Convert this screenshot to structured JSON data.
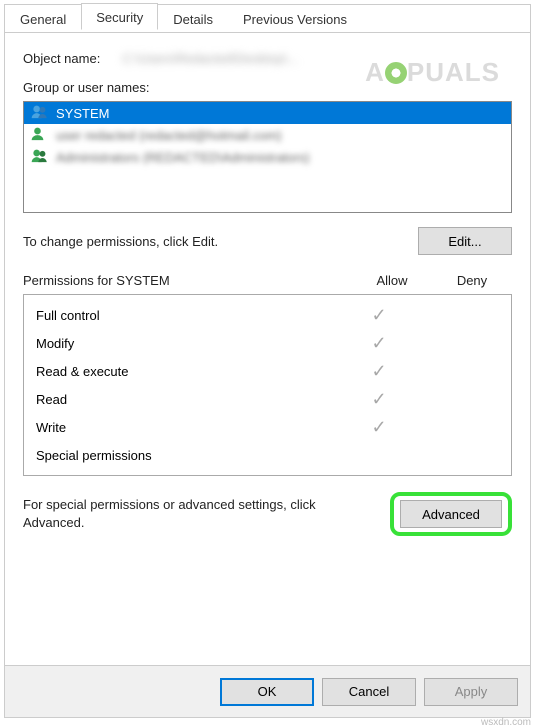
{
  "tabs": {
    "general": "General",
    "security": "Security",
    "details": "Details",
    "previous": "Previous Versions"
  },
  "objectName": {
    "label": "Object name:",
    "value": "C:\\Users\\Redacted\\Desktop\\..."
  },
  "groupLabel": "Group or user names:",
  "users": [
    {
      "name": "SYSTEM",
      "type": "group",
      "selected": true
    },
    {
      "name": "user redacted (redacted@hotmail.com)",
      "type": "user",
      "selected": false
    },
    {
      "name": "Administrators (REDACTED\\Administrators)",
      "type": "group",
      "selected": false
    }
  ],
  "editHint": "To change permissions, click Edit.",
  "editBtn": "Edit...",
  "permHeader": {
    "for": "Permissions for SYSTEM",
    "allow": "Allow",
    "deny": "Deny"
  },
  "permissions": [
    {
      "name": "Full control",
      "allow": true,
      "deny": false
    },
    {
      "name": "Modify",
      "allow": true,
      "deny": false
    },
    {
      "name": "Read & execute",
      "allow": true,
      "deny": false
    },
    {
      "name": "Read",
      "allow": true,
      "deny": false
    },
    {
      "name": "Write",
      "allow": true,
      "deny": false
    },
    {
      "name": "Special permissions",
      "allow": false,
      "deny": false
    }
  ],
  "advHint": "For special permissions or advanced settings, click Advanced.",
  "advBtn": "Advanced",
  "buttons": {
    "ok": "OK",
    "cancel": "Cancel",
    "apply": "Apply"
  },
  "watermark": {
    "pre": "A",
    "post": "PUALS"
  },
  "source": "wsxdn.com"
}
